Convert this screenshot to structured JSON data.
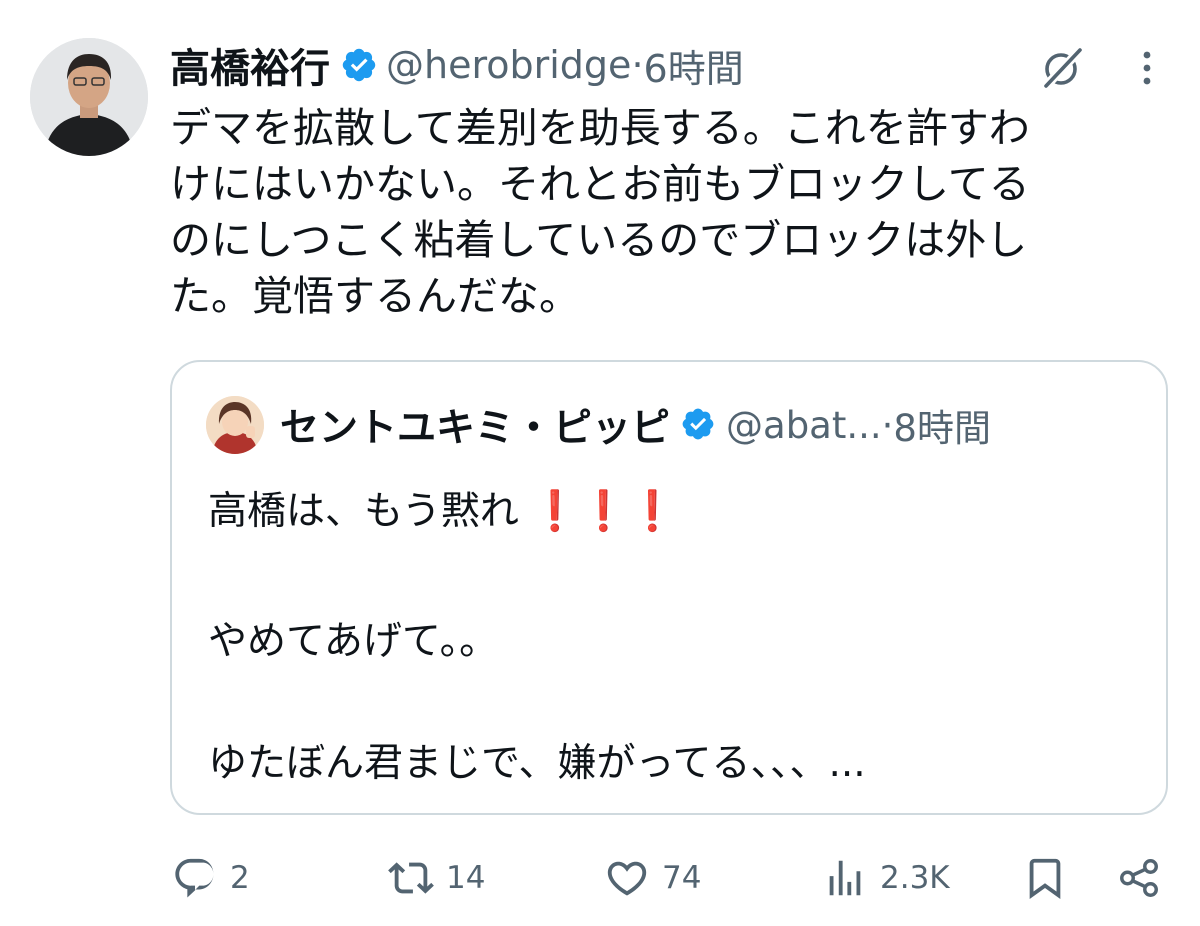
{
  "tweet": {
    "name": "高橋裕行",
    "handle": "@herobridge",
    "time_sep": " · ",
    "time": "6時間",
    "text": "デマを拡散して差別を助長する。これを許すわ\nけにはいかない。それとお前もブロックしてる\nのにしつこく粘着しているのでブロックは外し\nた。覚悟するんだな。"
  },
  "quote": {
    "name": "セントユキミ・ピッピ",
    "handle": "@abat...",
    "time_sep": " · ",
    "time": "8時間",
    "line1": "高橋は、もう黙れ",
    "exclamations": "❗❗❗",
    "line2": "やめてあげて。。",
    "line3": "ゆたぼん君まじで、嫌がってる、、、..."
  },
  "actions": {
    "replies": "2",
    "retweets": "14",
    "likes": "74",
    "views": "2.3K"
  },
  "colors": {
    "verified": "#1d9bf0",
    "muted": "#536471",
    "border": "#cfd9de",
    "exclamation": "#e0102a"
  },
  "icons": [
    "verified-badge-icon",
    "grok-icon",
    "more-icon",
    "reply-icon",
    "retweet-icon",
    "like-icon",
    "views-icon",
    "bookmark-icon",
    "share-icon"
  ]
}
